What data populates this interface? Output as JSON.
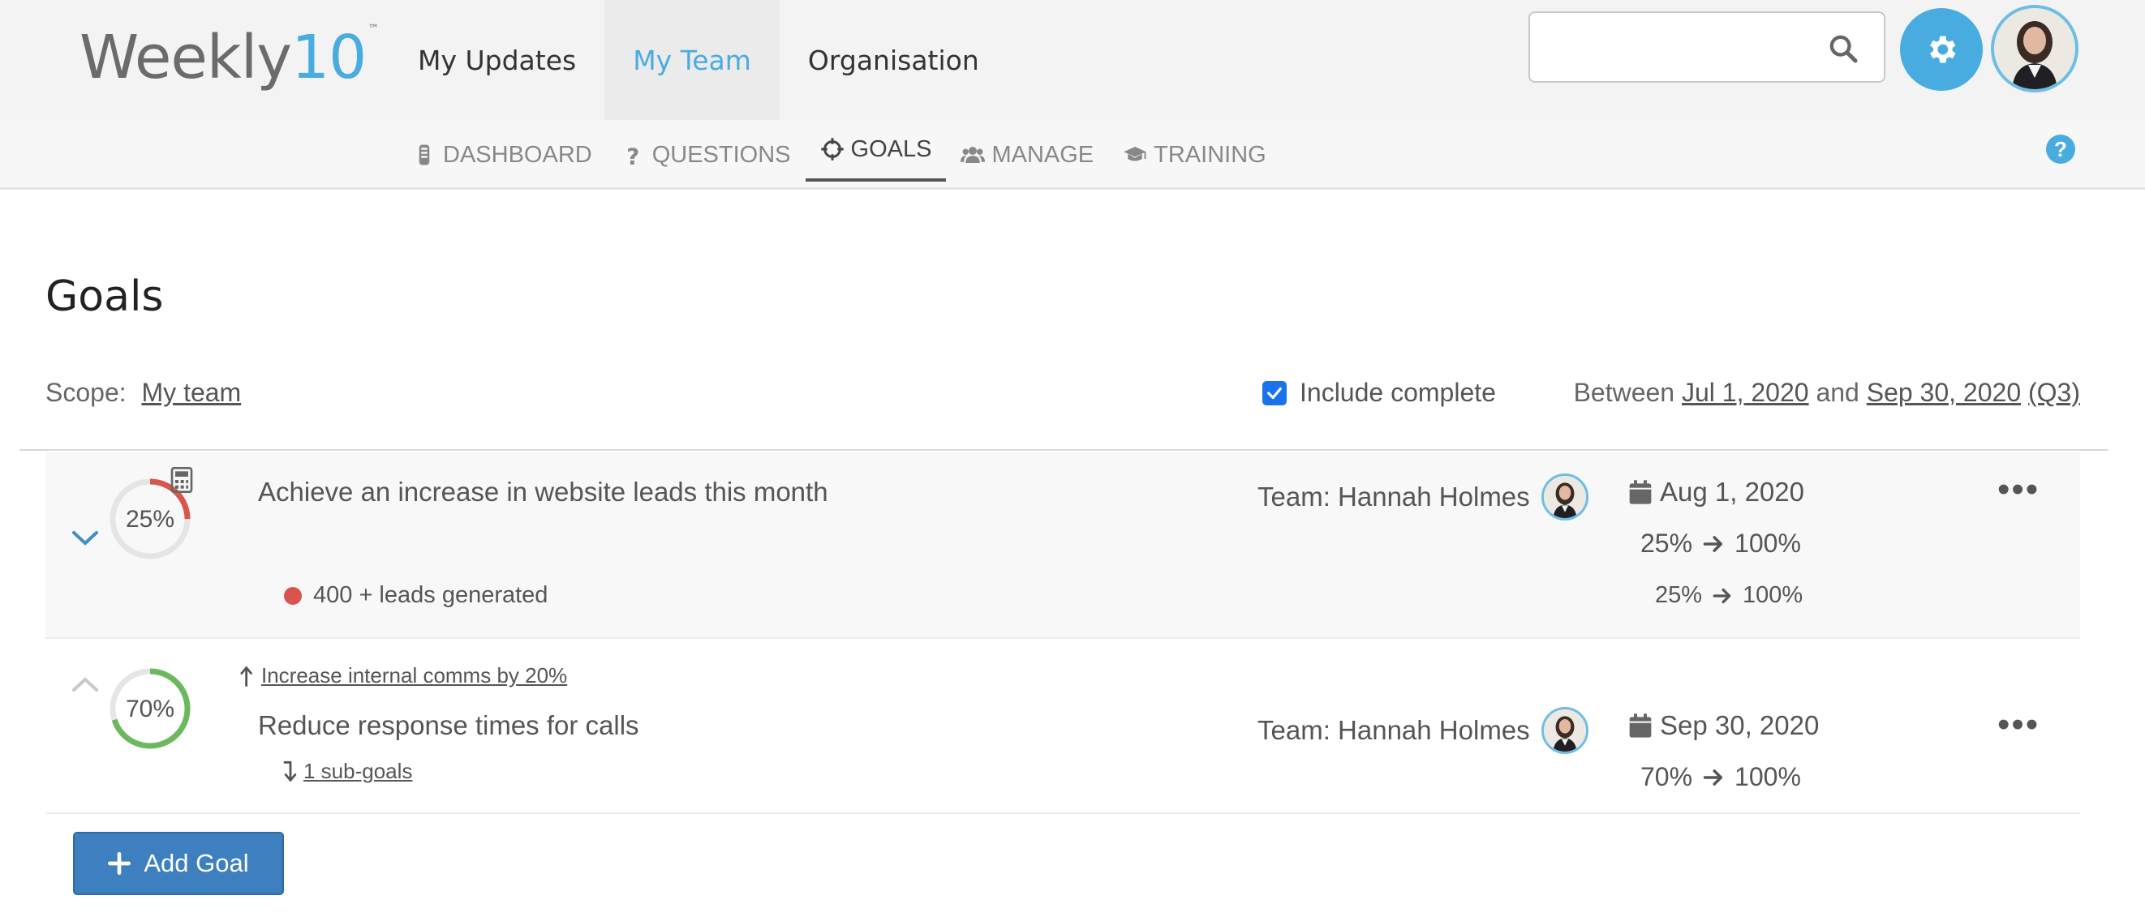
{
  "logo": {
    "text": "Weekly",
    "number": "10",
    "tm": "™"
  },
  "mainnav": [
    {
      "label": "My Updates",
      "active": false
    },
    {
      "label": "My Team",
      "active": true
    },
    {
      "label": "Organisation",
      "active": false
    }
  ],
  "search": {
    "placeholder": "",
    "value": ""
  },
  "subnav": [
    {
      "label": "DASHBOARD",
      "icon": "dashboard-icon"
    },
    {
      "label": "QUESTIONS",
      "icon": "question-icon"
    },
    {
      "label": "GOALS",
      "icon": "crosshair-icon",
      "active": true
    },
    {
      "label": "MANAGE",
      "icon": "users-icon"
    },
    {
      "label": "TRAINING",
      "icon": "graduation-cap-icon"
    }
  ],
  "page": {
    "title": "Goals",
    "scope_label": "Scope:",
    "scope_value": "My team",
    "include_complete_label": "Include complete",
    "include_complete_checked": true,
    "between_label": "Between",
    "start_date": "Jul 1, 2020",
    "and_label": "and",
    "end_date": "Sep 30, 2020",
    "quarter": "(Q3)"
  },
  "goals": [
    {
      "progress_label": "25%",
      "progress": 0.25,
      "progress_color": "#d9534f",
      "title": "Achieve an increase in website leads this month",
      "owner": "Team: Hannah Holmes",
      "due": "Aug 1, 2020",
      "from": "25%",
      "to": "100%",
      "key_result": {
        "label": "400 + leads generated",
        "from": "25%",
        "to": "100%"
      }
    },
    {
      "progress_label": "70%",
      "progress": 0.7,
      "progress_color": "#6cb85c",
      "parent_link": "Increase internal comms by 20%",
      "title": "Reduce response times for calls",
      "sub_goals": "1 sub-goals",
      "owner": "Team: Hannah Holmes",
      "due": "Sep 30, 2020",
      "from": "70%",
      "to": "100%"
    }
  ],
  "add_goal_label": "Add Goal",
  "colors": {
    "accent": "#49ace0",
    "button": "#3d7fbf"
  }
}
